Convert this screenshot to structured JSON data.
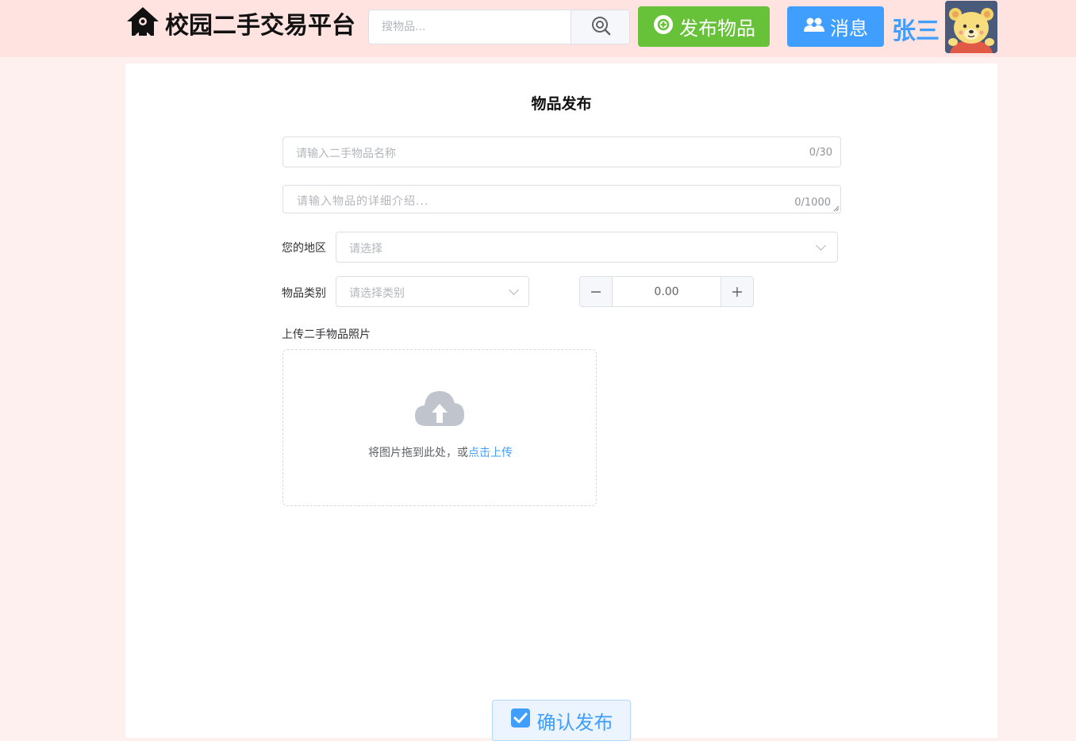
{
  "header": {
    "logo_title": "校园二手交易平台",
    "search_placeholder": "搜物品...",
    "publish_label": "发布物品",
    "message_label": "消息",
    "username": "张三"
  },
  "form": {
    "title": "物品发布",
    "name_placeholder": "请输入二手物品名称",
    "name_count": "0/30",
    "desc_placeholder": "请输入物品的详细介绍...",
    "desc_count": "0/1000",
    "region_label": "您的地区",
    "region_placeholder": "请选择",
    "category_label": "物品类别",
    "category_placeholder": "请选择类别",
    "price_value": "0.00",
    "upload_label": "上传二手物品照片",
    "upload_text": "将图片拖到此处，或",
    "upload_link": "点击上传",
    "confirm_label": "确认发布"
  },
  "colors": {
    "header_bg": "#ffe3e1",
    "page_bg": "#fff0f0",
    "primary": "#409eff",
    "success": "#67c23a"
  },
  "icons": [
    "home-icon",
    "search-icon",
    "add-circle-icon",
    "users-icon",
    "chevron-down-icon",
    "minus-icon",
    "plus-icon",
    "cloud-upload-icon",
    "checkbox-icon"
  ]
}
